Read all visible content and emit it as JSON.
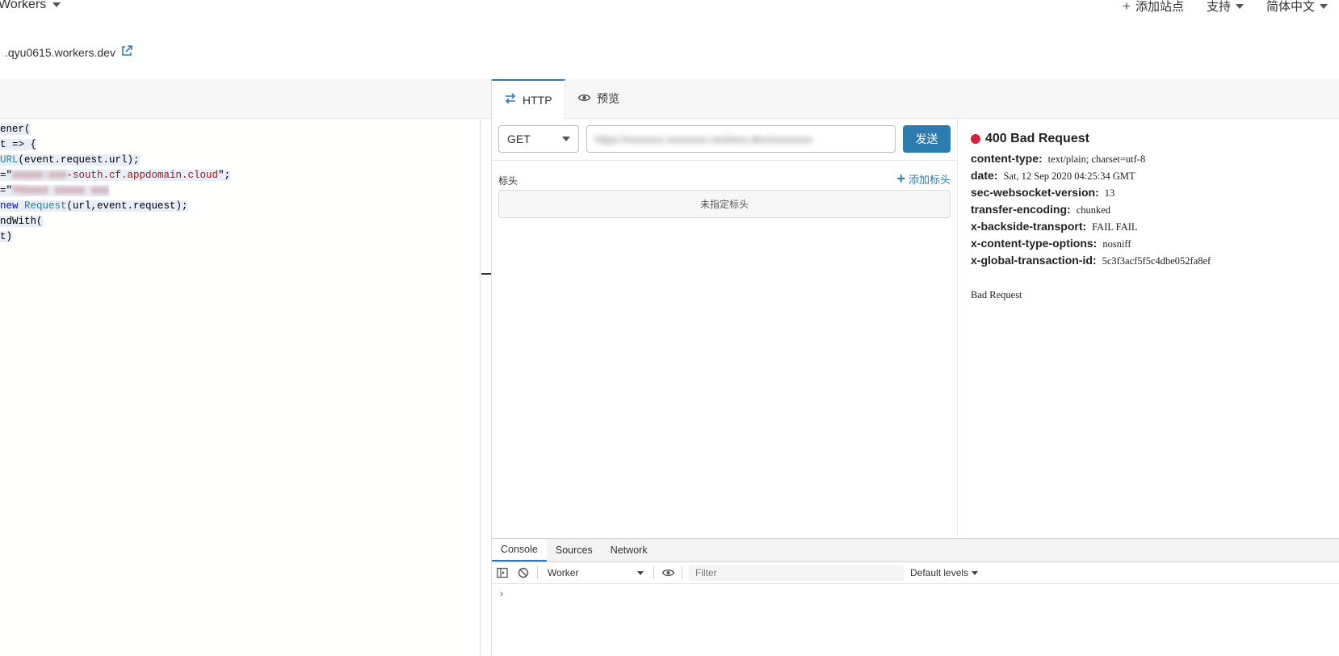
{
  "topnav": {
    "product": "Workers",
    "add_site": "添加站点",
    "support": "支持",
    "language": "简体中文"
  },
  "subheader": {
    "domain": ".qyu0615.workers.dev"
  },
  "editor": {
    "lines": [
      {
        "a": "ener("
      },
      {
        "a": "t => {"
      },
      {
        "cls": "URL",
        "a": "(event.request.url);"
      },
      {
        "a": "=\"",
        "redact": "xxxxx-xxx",
        "str": "-south.cf.appdomain.cloud",
        "b": "\";"
      },
      {
        "a": "=\"",
        "redact": "YVxxxx xxxxx xxx"
      },
      {
        "kw": "new ",
        "cls": "Request",
        "a": "(url,event.request);"
      },
      {
        "a": "ndWith("
      },
      {
        "a": "t)"
      }
    ]
  },
  "tabs": {
    "http": "HTTP",
    "preview": "预览"
  },
  "request": {
    "method": "GET",
    "url_placeholder": "https://xxxxxxx.xxxxxxxx.workers.dev/xxxxxxxx",
    "send": "发送",
    "headers_label": "标头",
    "add_header": "添加标头",
    "headers_empty": "未指定标头"
  },
  "response": {
    "status_color": "#d6203e",
    "status": "400 Bad Request",
    "headers": [
      {
        "key": "content-type:",
        "value": "text/plain; charset=utf-8"
      },
      {
        "key": "date:",
        "value": "Sat, 12 Sep 2020 04:25:34 GMT"
      },
      {
        "key": "sec-websocket-version:",
        "value": "13"
      },
      {
        "key": "transfer-encoding:",
        "value": "chunked"
      },
      {
        "key": "x-backside-transport:",
        "value": "FAIL FAIL"
      },
      {
        "key": "x-content-type-options:",
        "value": "nosniff"
      },
      {
        "key": "x-global-transaction-id:",
        "value": "5c3f3acf5f5c4dbe052fa8ef"
      }
    ],
    "body": "Bad Request"
  },
  "devtools": {
    "tabs": [
      "Console",
      "Sources",
      "Network"
    ],
    "active_tab": "Console",
    "context": "Worker",
    "filter_placeholder": "Filter",
    "levels": "Default levels",
    "prompt": "›"
  },
  "colors": {
    "accent": "#2c7cb0",
    "devtools_accent": "#1a73e8"
  }
}
